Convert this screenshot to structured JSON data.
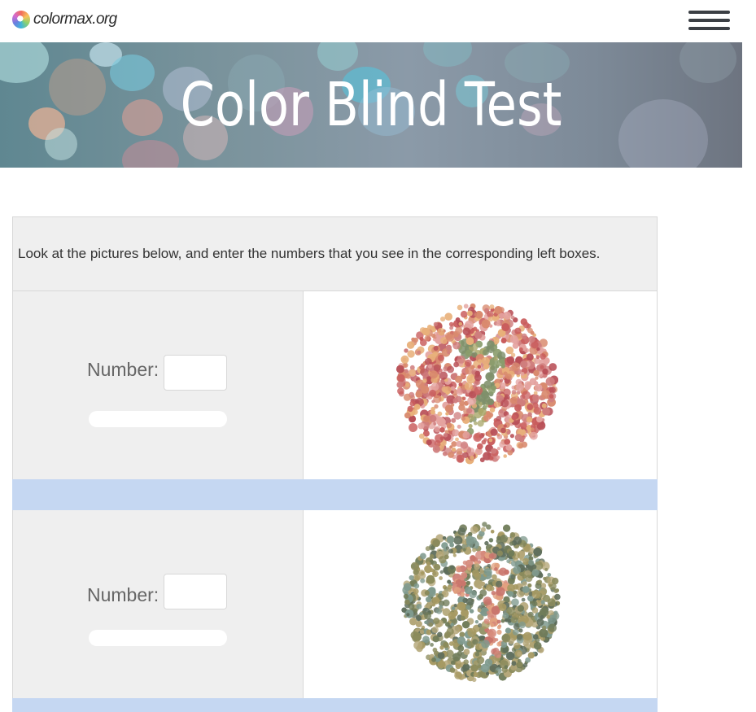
{
  "header": {
    "logo_text": "colormax.org",
    "menu_icon": "hamburger-menu-icon"
  },
  "hero": {
    "title": "Color Blind Test"
  },
  "quiz": {
    "instructions": "Look at the pictures below, and enter the numbers that you see in the corresponding left boxes.",
    "plates": [
      {
        "label": "Number:",
        "value": "",
        "plate_palette": [
          "#c95d5d",
          "#d98a6e",
          "#e8b07a",
          "#cf7d7d",
          "#e4a3a0",
          "#b84f57"
        ],
        "figure_palette": [
          "#8a9c6c",
          "#a9a76a",
          "#7e8f6a"
        ]
      },
      {
        "label": "Number:",
        "value": "",
        "plate_palette": [
          "#8b8b5c",
          "#a79a63",
          "#6f7b58",
          "#7f9a8e",
          "#b5a779",
          "#5e6d5b"
        ],
        "figure_palette": [
          "#d68a7c",
          "#e1a07f",
          "#c9756c"
        ]
      }
    ]
  },
  "colors": {
    "spacer": "#c5d7f2",
    "cell_bg": "#efefef",
    "border": "#d8d8d8"
  }
}
